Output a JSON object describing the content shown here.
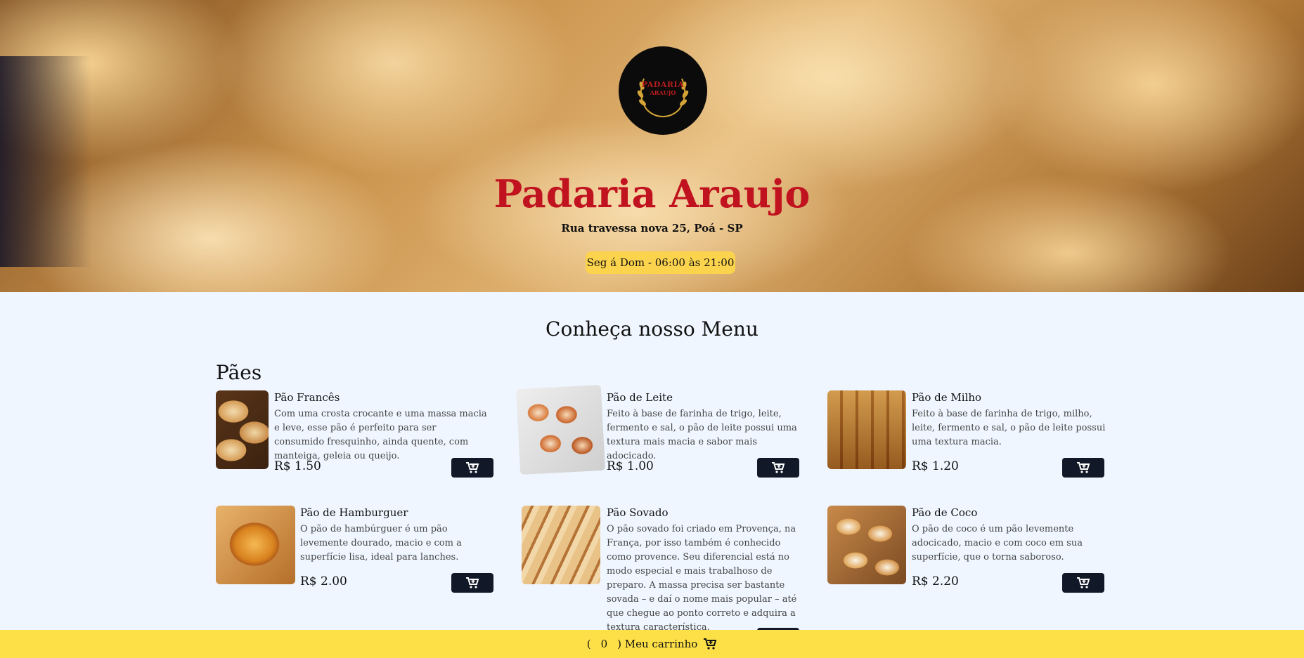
{
  "hero": {
    "logo_line1": "PADARIA",
    "logo_line2": "ARAUJO",
    "title": "Padaria Araujo",
    "address": "Rua travessa nova 25, Poá - SP",
    "hours": "Seg á Dom - 06:00 às 21:00"
  },
  "menu": {
    "title": "Conheça nosso Menu",
    "section": "Pães",
    "items": [
      {
        "name": "Pão Francês",
        "description": "Com uma crosta crocante e uma massa macia e leve, esse pão é perfeito para ser consumido fresquinho, ainda quente, com manteiga, geleia ou queijo.",
        "price": "R$ 1.50"
      },
      {
        "name": "Pão de Leite",
        "description": "Feito à base de farinha de trigo, leite, fermento e sal, o pão de leite possui uma textura mais macia e sabor mais adocicado.",
        "price": "R$ 1.00"
      },
      {
        "name": "Pão de Milho",
        "description": "Feito à base de farinha de trigo, milho, leite, fermento e sal, o pão de leite possui uma textura macia.",
        "price": "R$ 1.20"
      },
      {
        "name": "Pão de Hamburguer",
        "description": "O pão de hambúrguer é um pão levemente dourado, macio e com a superfície lisa, ideal para lanches.",
        "price": "R$ 2.00"
      },
      {
        "name": "Pão Sovado",
        "description": "O pão sovado foi criado em Provença, na França, por isso também é conhecido como provence. Seu diferencial está no modo especial e mais trabalhoso de preparo. A massa precisa ser bastante sovada – e daí o nome mais popular – até que chegue ao ponto correto e adquira a textura característica.",
        "price": ""
      },
      {
        "name": "Pão de Coco",
        "description": "O pão de coco é um pão levemente adocicado, macio e com coco em sua superfície, que o torna saboroso.",
        "price": "R$ 2.20"
      }
    ],
    "cart_icon": "cart-plus-icon"
  },
  "footer": {
    "open_paren": "(",
    "count": "0",
    "label": ") Meu carrinho",
    "icon": "cart-icon"
  },
  "colors": {
    "title_red": "#c1121f",
    "accent_yellow": "#fde047",
    "button_dark": "#111827",
    "page_bg": "#eff6ff"
  }
}
